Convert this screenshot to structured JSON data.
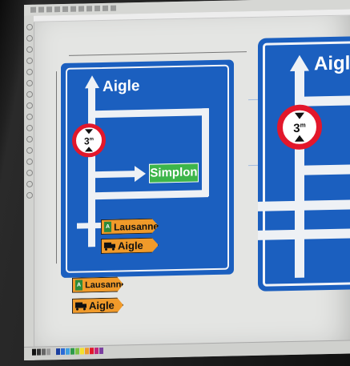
{
  "sign_left": {
    "destination_top": "Aigle",
    "destination_right": "Simplon",
    "restriction_value": "3",
    "restriction_unit": "m",
    "route_signs": [
      {
        "label": "Lausanne",
        "kind": "motorway"
      },
      {
        "label": "Aigle",
        "kind": "truck"
      }
    ]
  },
  "sign_right": {
    "destination_top": "Aigle",
    "restriction_value": "3",
    "restriction_unit": "m"
  },
  "loose_signs": [
    {
      "label": "Lausanne",
      "kind": "motorway"
    },
    {
      "label": "Aigle",
      "kind": "truck"
    }
  ],
  "colors": {
    "sign_blue": "#1b5fbf",
    "restriction_red": "#e2172b",
    "direction_green": "#3db54a",
    "route_orange": "#f09a2a"
  }
}
